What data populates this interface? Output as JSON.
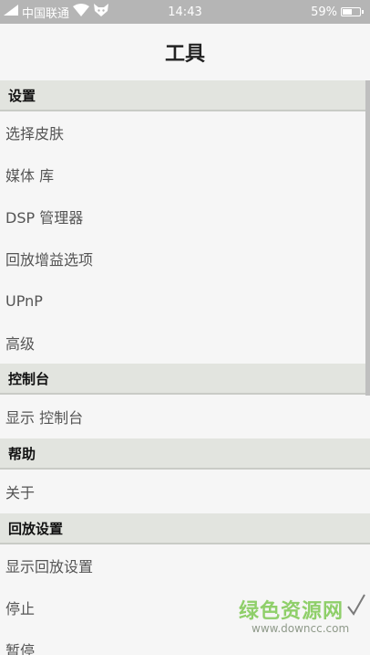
{
  "status_bar": {
    "carrier": "中国联通",
    "time": "14:43",
    "battery": "59%",
    "battery_level": 0.59,
    "icons": [
      "signal-icon",
      "wifi-icon",
      "fox-app-icon",
      "battery-icon"
    ]
  },
  "header": {
    "title": "工具"
  },
  "sections": [
    {
      "title": "设置",
      "items": [
        "选择皮肤",
        "媒体 库",
        "DSP 管理器",
        "回放增益选项",
        "UPnP",
        "高级"
      ]
    },
    {
      "title": "控制台",
      "items": [
        "显示 控制台"
      ]
    },
    {
      "title": "帮助",
      "items": [
        "关于"
      ]
    },
    {
      "title": "回放设置",
      "items": [
        "显示回放设置",
        "停止",
        "暂停"
      ]
    }
  ],
  "watermark": {
    "text": "绿色资源网",
    "url": "www.downcc.com"
  }
}
